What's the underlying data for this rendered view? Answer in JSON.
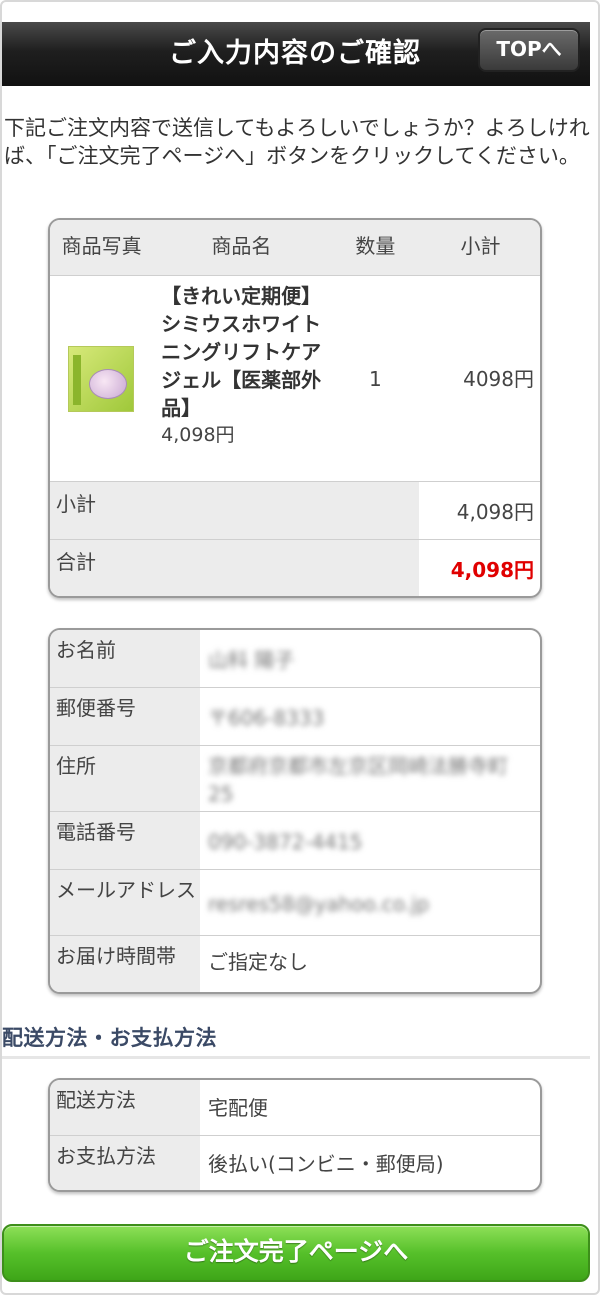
{
  "header": {
    "title": "ご入力内容のご確認",
    "top_button": "TOPへ"
  },
  "intro": "下記ご注文内容で送信してもよろしいでしょうか？よろしければ、「ご注文完了ページへ」ボタンをクリックしてください。",
  "order": {
    "headers": {
      "photo": "商品写真",
      "name": "商品名",
      "qty": "数量",
      "subtotal": "小計"
    },
    "item": {
      "name": "【きれい定期便】シミウスホワイトニングリフトケアジェル【医薬部外品】",
      "price": "4,098円",
      "qty": "1",
      "subtotal": "4098円"
    },
    "subtotal_label": "小計",
    "subtotal_value": "4,098円",
    "total_label": "合計",
    "total_value": "4,098円",
    "total_color": "#e00000"
  },
  "customer": {
    "name_label": "お名前",
    "name_value": "山科 陽子",
    "postal_label": "郵便番号",
    "postal_value": "〒606-8333",
    "address_label": "住所",
    "address_value": "京都府京都市左京区岡崎法勝寺町25",
    "phone_label": "電話番号",
    "phone_value": "090-3872-4415",
    "email_label": "メールアドレス",
    "email_value": "resres58@yahoo.co.jp",
    "time_label": "お届け時間帯",
    "time_value": "ご指定なし"
  },
  "shipping": {
    "section_title": "配送方法・お支払方法",
    "method_label": "配送方法",
    "method_value": "宅配便",
    "payment_label": "お支払方法",
    "payment_value": "後払い(コンビニ・郵便局)"
  },
  "cta": {
    "label": "ご注文完了ページへ",
    "color": "#56c02a"
  }
}
